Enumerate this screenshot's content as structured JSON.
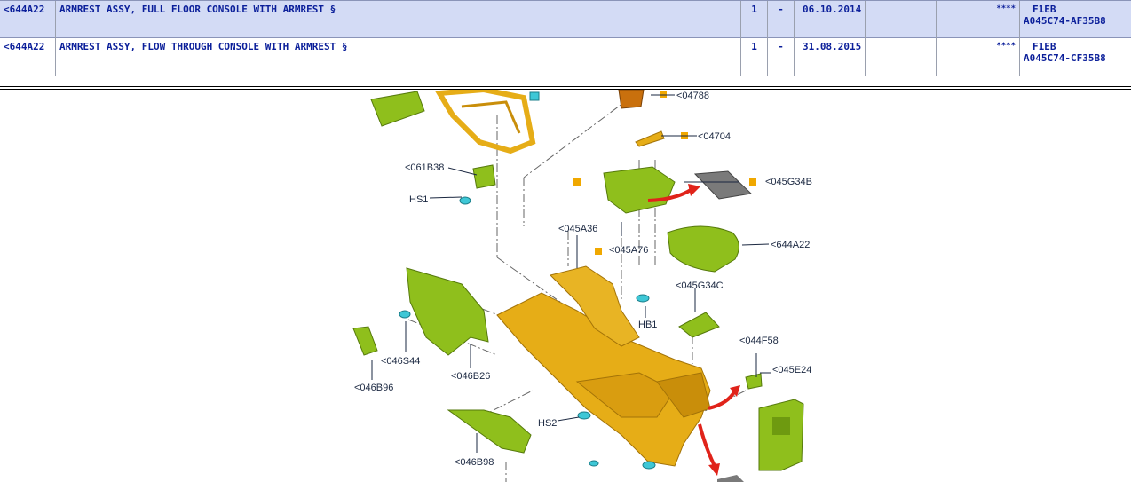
{
  "parts_table": {
    "rows": [
      {
        "code": "<644A22",
        "description": "ARMREST ASSY, FULL FLOOR CONSOLE WITH ARMREST §",
        "qty": "1",
        "sep": "-",
        "date": "06.10.2014",
        "col6": "",
        "flag": "****",
        "ref1": "F1EB",
        "ref2": "A045C74-AF35B8"
      },
      {
        "code": "<644A22",
        "description": "ARMREST ASSY, FLOW THROUGH CONSOLE WITH ARMREST §",
        "qty": "1",
        "sep": "-",
        "date": "31.08.2015",
        "col6": "",
        "flag": "****",
        "ref1": "F1EB",
        "ref2": "A045C74-CF35B8"
      }
    ]
  },
  "diagram": {
    "labels": {
      "l04788": "<04788",
      "l04704": "<04704",
      "l061B38": "<061B38",
      "lHS1": "HS1",
      "l045G34B": "<045G34B",
      "l045A36": "<045A36",
      "l045A76": "<045A76",
      "l644A22": "<644A22",
      "l045G34C": "<045G34C",
      "lHB1": "HB1",
      "l044F58": "<044F58",
      "l045E24": "<045E24",
      "l046S44": "<046S44",
      "l046B26": "<046B26",
      "l046B96": "<046B96",
      "lHS2": "HS2",
      "l046B98": "<046B98"
    },
    "colors": {
      "console": "#e6ad17",
      "trim": "#8fbf1c",
      "clip": "#3ec7d6",
      "marker": "#f0a800",
      "arrow": "#e0231a",
      "orange": "#c9700d",
      "mat": "#7a7a7a"
    }
  }
}
